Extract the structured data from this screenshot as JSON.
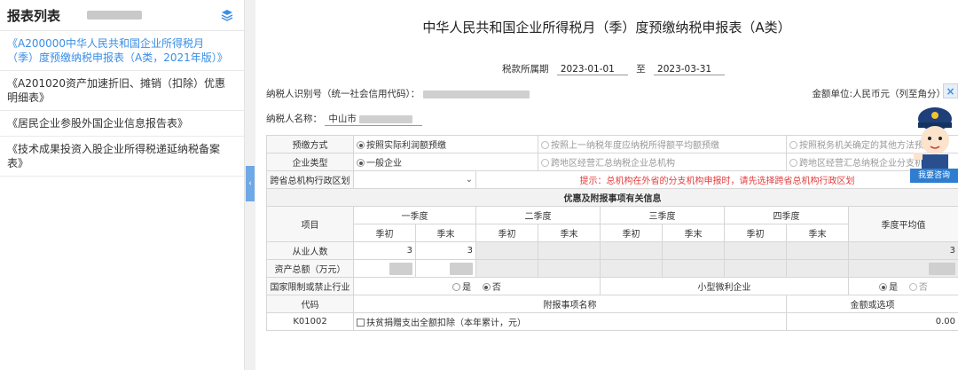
{
  "sidebar": {
    "title": "报表列表",
    "items": [
      {
        "label": "《A200000中华人民共和国企业所得税月（季）度预缴纳税申报表（A类，2021年版）》",
        "active": true
      },
      {
        "label": "《A201020资产加速折旧、摊销（扣除）优惠明细表》",
        "active": false
      },
      {
        "label": "《居民企业参股外国企业信息报告表》",
        "active": false
      },
      {
        "label": "《技术成果投资入股企业所得税递延纳税备案表》",
        "active": false
      }
    ],
    "collapse_glyph": "‹"
  },
  "form": {
    "title": "中华人民共和国企业所得税月（季）度预缴纳税申报表（A类）",
    "period_label": "税款所属期",
    "period_start": "2023-01-01",
    "period_to": "至",
    "period_end": "2023-03-31",
    "taxpayer_id_label": "纳税人识别号（统一社会信用代码）：",
    "unit_label": "金额单位:人民币元（列至角分）",
    "taxpayer_name_label": "纳税人名称：",
    "taxpayer_name_value": "中山市"
  },
  "helper": {
    "close": "×",
    "consult": "我要咨询"
  },
  "table": {
    "prepay_label": "预缴方式",
    "prepay_opt1": "按照实际利润额预缴",
    "prepay_opt2": "按照上一纳税年度应纳税所得额平均额预缴",
    "prepay_opt3": "按照税务机关确定的其他方法预缴",
    "ent_label": "企业类型",
    "ent_opt1": "一般企业",
    "ent_opt2": "跨地区经营汇总纳税企业总机构",
    "ent_opt3": "跨地区经营汇总纳税企业分支机构",
    "region_label": "跨省总机构行政区划",
    "region_tip": "提示：总机构在外省的分支机构申报时，请先选择跨省总机构行政区划",
    "section_title": "优惠及附报事项有关信息",
    "item_label": "项目",
    "quarters": [
      "一季度",
      "二季度",
      "三季度",
      "四季度"
    ],
    "q_start": "季初",
    "q_end": "季末",
    "avg_label": "季度平均值",
    "row_emp": {
      "label": "从业人数",
      "q1_start": "3",
      "q1_end": "3",
      "avg": "3"
    },
    "row_assets": {
      "label": "资产总额（万元）"
    },
    "restricted": {
      "label": "国家限制或禁止行业",
      "yes": "是",
      "no": "否"
    },
    "smallprofit": {
      "label": "小型微利企业",
      "yes": "是",
      "no": "否"
    },
    "code_label": "代码",
    "appendix_label": "附报事项名称",
    "amount_label": "金额或选项",
    "k01002": {
      "code": "K01002",
      "name": "扶贫捐赠支出全额扣除（本年累计，元）",
      "amount": "0.00"
    }
  }
}
